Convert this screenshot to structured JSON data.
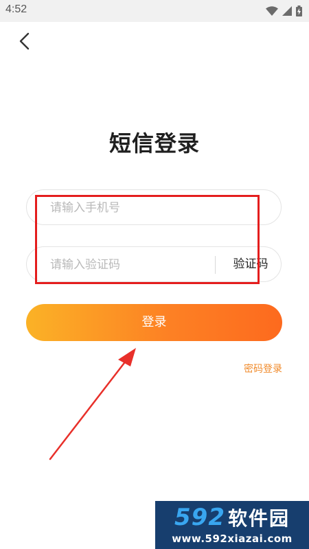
{
  "status_bar": {
    "time": "4:52",
    "icons": [
      "wifi-icon",
      "cellular-signal-icon",
      "battery-charging-icon"
    ]
  },
  "nav": {
    "back_icon": "chevron-left-icon"
  },
  "title": "短信登录",
  "form": {
    "phone_placeholder": "请输入手机号",
    "phone_value": "",
    "code_placeholder": "请输入验证码",
    "code_value": "",
    "get_code_label": "验证码"
  },
  "login_button_label": "登录",
  "password_login_label": "密码登录",
  "colors": {
    "accent_start": "#fbb226",
    "accent_end": "#fd6a1e",
    "link": "#f08a2a",
    "highlight": "#e41d1d"
  },
  "watermark": {
    "digits": "592",
    "name": "软件园",
    "url": "www.592xiazai.com"
  }
}
